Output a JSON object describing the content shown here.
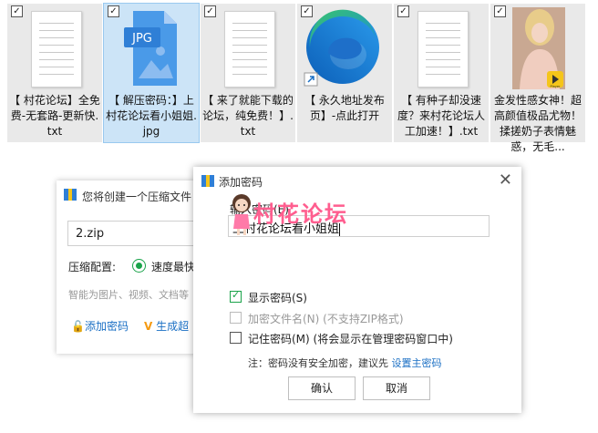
{
  "files": [
    {
      "name": "【 村花论坛】全免费-无套路-更新快.txt",
      "type": "txt",
      "checked": true,
      "selected": false
    },
    {
      "name": "【 解压密码：】上村花论坛看小姐姐.jpg",
      "type": "jpg",
      "checked": true,
      "selected": true,
      "badge": "JPG"
    },
    {
      "name": "【 来了就能下载的论坛，纯免费！】.txt",
      "type": "txt",
      "checked": true,
      "selected": false
    },
    {
      "name": "【 永久地址发布页】-点此打开",
      "type": "edge-shortcut",
      "checked": true,
      "selected": false
    },
    {
      "name": "【 有种子却没速度？来村花论坛人工加速！】.txt",
      "type": "txt",
      "checked": true,
      "selected": false
    },
    {
      "name": "金发性感女神！超高颜值极品尤物！揉搓奶子表情魅惑，无毛...",
      "type": "video",
      "checked": true,
      "selected": false,
      "badge": "Player"
    }
  ],
  "compress_dialog": {
    "title": "您将创建一个压缩文件",
    "filename": "2.zip",
    "config_label": "压缩配置:",
    "speed_option": "速度最快",
    "smart_hint": "智能为图片、视频、文档等",
    "add_password": "添加密码",
    "generate": "生成超"
  },
  "password_dialog": {
    "title": "添加密码",
    "password_label": "输入密码(E)",
    "password_value": "上村花论坛看小姐姐",
    "options": [
      {
        "label": "显示密码(S)",
        "checked": true,
        "disabled": false
      },
      {
        "label": "加密文件名(N)  (不支持ZIP格式)",
        "checked": false,
        "disabled": true
      },
      {
        "label": "记住密码(M)  (将会显示在管理密码窗口中)",
        "checked": false,
        "disabled": false
      }
    ],
    "note_prefix": "注：密码没有安全加密，建议先",
    "note_link": "设置主密码",
    "ok": "确认",
    "cancel": "取消"
  },
  "watermark": "村花论坛",
  "colors": {
    "accent_green": "#1aa34a",
    "link_blue": "#1a6fc4",
    "watermark_pink": "#ff5e8f",
    "selection": "#cce4f7"
  }
}
